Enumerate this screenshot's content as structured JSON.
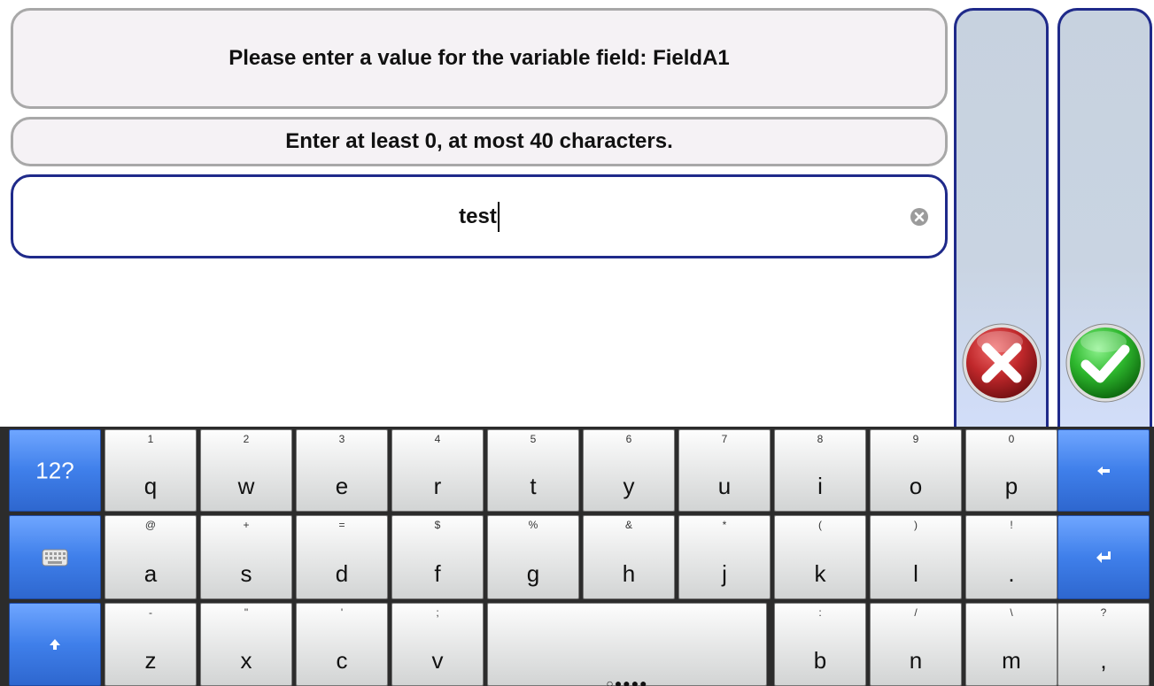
{
  "dialog": {
    "prompt": "Please enter a value for the variable field: FieldA1",
    "hint": "Enter at least 0, at most 40 characters.",
    "input_value": "test"
  },
  "icons": {
    "clear": "clear-x-circle-icon",
    "cancel": "red-x-icon",
    "confirm": "green-check-icon",
    "backspace": "backspace-arrow-icon",
    "enter": "enter-arrow-icon",
    "shift": "shift-up-arrow-icon",
    "hide_keyboard": "keyboard-icon"
  },
  "colors": {
    "accent_border": "#1f2a8a",
    "key_blue": "#3f7fea",
    "cancel_red": "#c0282b",
    "confirm_green": "#2eb82e"
  },
  "keyboard": {
    "mode_key": "12?",
    "rows": [
      [
        {
          "sub": "1",
          "main": "q"
        },
        {
          "sub": "2",
          "main": "w"
        },
        {
          "sub": "3",
          "main": "e"
        },
        {
          "sub": "4",
          "main": "r"
        },
        {
          "sub": "5",
          "main": "t"
        },
        {
          "sub": "6",
          "main": "y"
        },
        {
          "sub": "7",
          "main": "u"
        },
        {
          "sub": "8",
          "main": "i"
        },
        {
          "sub": "9",
          "main": "o"
        },
        {
          "sub": "0",
          "main": "p"
        }
      ],
      [
        {
          "sub": "@",
          "main": "a"
        },
        {
          "sub": "+",
          "main": "s"
        },
        {
          "sub": "=",
          "main": "d"
        },
        {
          "sub": "$",
          "main": "f"
        },
        {
          "sub": "%",
          "main": "g"
        },
        {
          "sub": "&",
          "main": "h"
        },
        {
          "sub": "*",
          "main": "j"
        },
        {
          "sub": "(",
          "main": "k"
        },
        {
          "sub": ")",
          "main": "l"
        },
        {
          "sub": "!",
          "main": "."
        }
      ],
      [
        {
          "sub": "-",
          "main": "z"
        },
        {
          "sub": "\"",
          "main": "x"
        },
        {
          "sub": "'",
          "main": "c"
        },
        {
          "sub": ";",
          "main": "v"
        },
        {
          "sub": ":",
          "main": "b"
        },
        {
          "sub": "/",
          "main": "n"
        },
        {
          "sub": "\\",
          "main": "m"
        },
        {
          "sub": "?",
          "main": ","
        }
      ]
    ],
    "space_indicator": "○●●●●"
  }
}
